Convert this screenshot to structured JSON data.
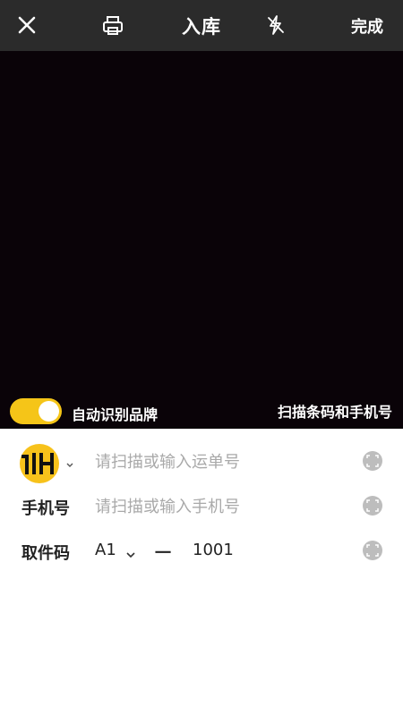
{
  "header": {
    "close_icon": "close-icon",
    "print_icon": "printer-icon",
    "title": "入库",
    "flash_icon": "flash-off-icon",
    "done_label": "完成"
  },
  "camera": {
    "auto_brand_label": "自动识别品牌",
    "auto_brand_enabled": true,
    "scan_hint": "扫描条码和手机号"
  },
  "form": {
    "brand_chevron_icon": "chevron-down-icon",
    "tracking_placeholder": "请扫描或输入运单号",
    "phone_label": "手机号",
    "phone_placeholder": "请扫描或输入手机号",
    "pickup_label": "取件码",
    "shelf_value": "A1",
    "separator": "一",
    "pickup_number": "1001",
    "scan_icon": "scan-icon"
  },
  "colors": {
    "accent": "#f5c518",
    "topbar_bg": "#2b2b2b",
    "camera_bg": "#0a0308",
    "placeholder": "#a9a9a9"
  }
}
